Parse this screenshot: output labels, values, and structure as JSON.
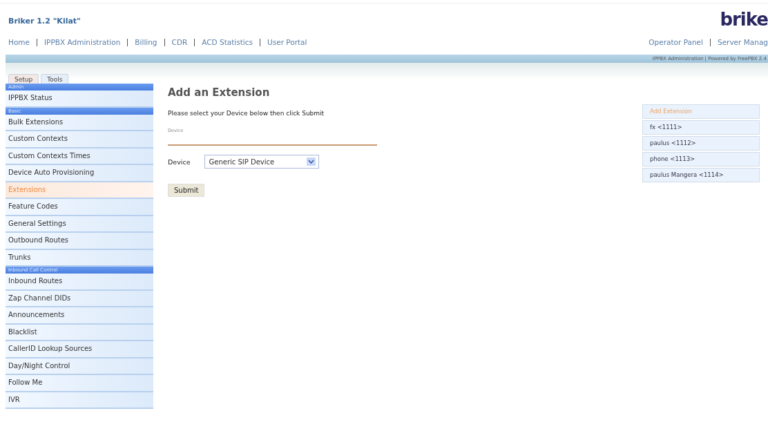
{
  "header": {
    "title": "Briker 1.2 \"Kilat\"",
    "logo": "brike"
  },
  "nav": {
    "left": [
      "Home",
      "IPPBX Administration",
      "Billing",
      "CDR",
      "ACD Statistics",
      "User Portal"
    ],
    "right": [
      "Operator Panel",
      "Server Manag"
    ]
  },
  "banner": {
    "text": "IPPBX Administration | Powered by FreePBX 2.4"
  },
  "tabs": [
    {
      "label": "Setup",
      "selected": true
    },
    {
      "label": "Tools",
      "selected": false
    }
  ],
  "sidebar": {
    "items": [
      {
        "kind": "header",
        "label": "Admin"
      },
      {
        "kind": "item",
        "label": "IPPBX Status",
        "selected": false
      },
      {
        "kind": "header",
        "label": "Basic"
      },
      {
        "kind": "item",
        "label": "Bulk Extensions",
        "selected": false
      },
      {
        "kind": "item",
        "label": "Custom Contexts",
        "selected": false
      },
      {
        "kind": "item",
        "label": "Custom Contexts Times",
        "selected": false
      },
      {
        "kind": "item",
        "label": "Device Auto Provisioning",
        "selected": false
      },
      {
        "kind": "item",
        "label": "Extensions",
        "selected": true
      },
      {
        "kind": "item",
        "label": "Feature Codes",
        "selected": false
      },
      {
        "kind": "item",
        "label": "General Settings",
        "selected": false
      },
      {
        "kind": "item",
        "label": "Outbound Routes",
        "selected": false
      },
      {
        "kind": "item",
        "label": "Trunks",
        "selected": false
      },
      {
        "kind": "header",
        "label": "Inbound Call Control"
      },
      {
        "kind": "item",
        "label": "Inbound Routes",
        "selected": false
      },
      {
        "kind": "item",
        "label": "Zap Channel DIDs",
        "selected": false
      },
      {
        "kind": "item",
        "label": "Announcements",
        "selected": false
      },
      {
        "kind": "item",
        "label": "Blacklist",
        "selected": false
      },
      {
        "kind": "item",
        "label": "CallerID Lookup Sources",
        "selected": false
      },
      {
        "kind": "item",
        "label": "Day/Night Control",
        "selected": false
      },
      {
        "kind": "item",
        "label": "Follow Me",
        "selected": false
      },
      {
        "kind": "item",
        "label": "IVR",
        "selected": false
      }
    ]
  },
  "main": {
    "heading": "Add an Extension",
    "instruction": "Please select your Device below then click Submit",
    "section_label": "Device",
    "field_label": "Device",
    "device_value": "Generic SIP Device",
    "submit": "Submit"
  },
  "extensions": [
    {
      "label": "Add Extension",
      "selected": true
    },
    {
      "label": "fx <1111>",
      "selected": false
    },
    {
      "label": "paulus <1112>",
      "selected": false
    },
    {
      "label": "phone <1113>",
      "selected": false
    },
    {
      "label": "paulus Mangera <1114>",
      "selected": false
    }
  ]
}
